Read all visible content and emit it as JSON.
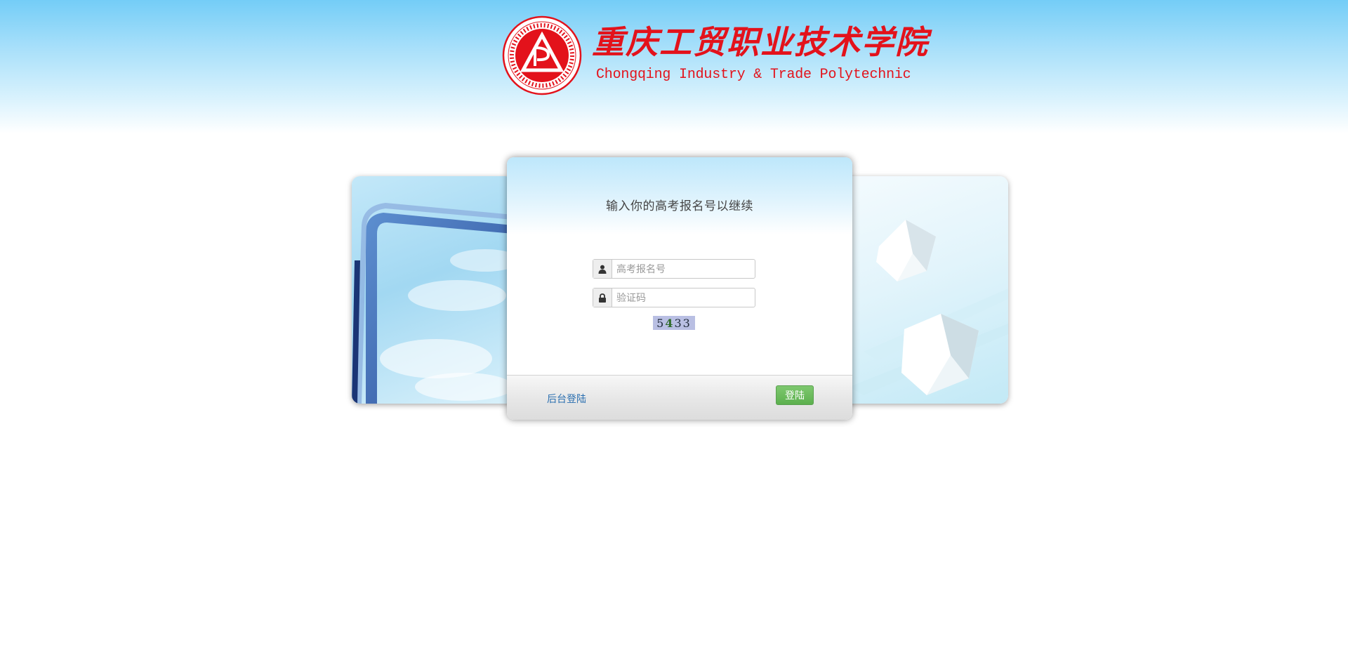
{
  "header": {
    "school_name_cn": "重庆工贸职业技术学院",
    "school_name_en": "Chongqing Industry & Trade Polytechnic",
    "seal_text": "重庆工贸职业技术学院 CHONG QING INDUSTRY&TRADE POLYTECHNIC",
    "brand_color": "#e3121b"
  },
  "login": {
    "title": "输入你的高考报名号以继续",
    "username_placeholder": "高考报名号",
    "captcha_placeholder": "验证码",
    "captcha_digits": [
      "5",
      "4",
      "3",
      "3"
    ],
    "admin_link_label": "后台登陆",
    "submit_label": "登陆",
    "accent_color": "#5cb04e",
    "link_color": "#2a6fb0"
  },
  "icons": {
    "username": "user-icon",
    "captcha": "lock-icon"
  }
}
